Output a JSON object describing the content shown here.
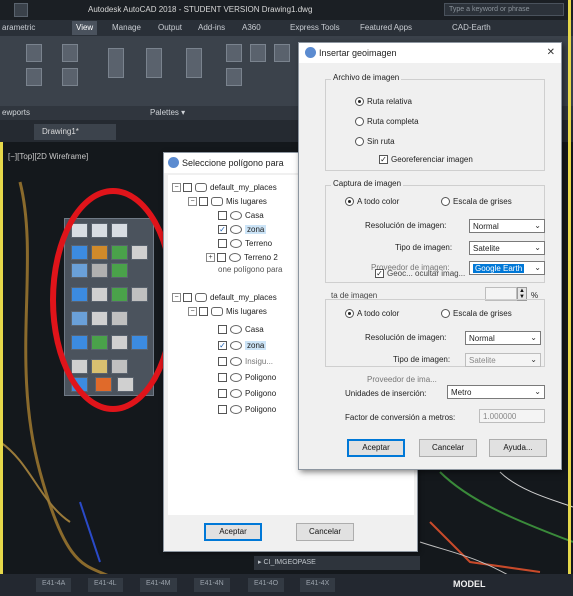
{
  "app": {
    "title": "Autodesk AutoCAD 2018 - STUDENT VERSION    Drawing1.dwg",
    "search_placeholder": "Type a keyword or phrase",
    "ribbon_tabs": [
      "arametric",
      "View",
      "Manage",
      "Output",
      "Add-ins",
      "A360",
      "Express Tools",
      "Featured Apps",
      "CAD-Earth"
    ],
    "active_tab": "View",
    "ribbon_groups": [
      "ewports",
      "Palettes ▾"
    ],
    "file_tab": "Drawing1*",
    "viewport_label": "[−][Top][2D Wireframe]",
    "model_label": "MODEL",
    "layout_tabs": [
      "E41-4A",
      "E41-4L",
      "E41-4M",
      "E41-4N",
      "E41-4O",
      "E41-4X"
    ],
    "command_line": "▸ CI_IMGEOPASE"
  },
  "select_dialog": {
    "title": "Seleccione polígono para",
    "tree_top": [
      {
        "label": "default_my_places",
        "level": 0,
        "expander": "⊟",
        "checked": false
      },
      {
        "label": "Mis lugares",
        "level": 1,
        "expander": "⊟",
        "checked": false
      },
      {
        "label": "Casa",
        "level": 2,
        "checked": false
      },
      {
        "label": "zona",
        "level": 2,
        "checked": true,
        "selected": true
      },
      {
        "label": "Terreno",
        "level": 2,
        "checked": false
      },
      {
        "label": "Terreno 2",
        "level": 2,
        "checked": false,
        "expander": "⊞"
      }
    ],
    "overlap_text": "one polígono para",
    "tree_bottom": [
      {
        "label": "default_my_places",
        "level": 0,
        "expander": "⊟",
        "checked": false
      },
      {
        "label": "Mis lugares",
        "level": 1,
        "expander": "⊟",
        "checked": false
      },
      {
        "label": "Casa",
        "level": 2,
        "checked": false
      },
      {
        "label": "zona",
        "level": 2,
        "checked": true,
        "selected": true
      },
      {
        "label": "Insigu...",
        "level": 2,
        "checked": false
      },
      {
        "label": "Poligono",
        "level": 2,
        "checked": false
      },
      {
        "label": "Poligono",
        "level": 2,
        "checked": false
      },
      {
        "label": "Poligono",
        "level": 2,
        "checked": false
      }
    ],
    "ok_label": "Aceptar",
    "cancel_label": "Cancelar"
  },
  "geo_dialog": {
    "title": "Insertar geoimagen",
    "close": "✕",
    "archivo_group": "Archivo de imagen",
    "path_options": [
      {
        "label": "Ruta relativa",
        "selected": true
      },
      {
        "label": "Ruta completa",
        "selected": false
      },
      {
        "label": "Sin ruta",
        "selected": false
      }
    ],
    "georef_label": "Georeferenciar imagen",
    "georef_checked": true,
    "captura_group": "Captura de imagen",
    "color_options": [
      {
        "label": "A todo color",
        "selected": true
      },
      {
        "label": "Escala de grises",
        "selected": false
      }
    ],
    "resolution_label": "Resolución de imagen:",
    "resolution_value": "Normal",
    "type_label": "Tipo de imagen:",
    "type_value": "Satelite",
    "provider_label": "Proveedor de imagen:",
    "provider_value": "Google Earth",
    "ghost_check_label": "Geoc... ocultar imag...",
    "size_group": "ta de imagen",
    "percent": "%",
    "color_options_2": [
      {
        "label": "A todo color",
        "selected": true
      },
      {
        "label": "Escala de grises",
        "selected": false
      }
    ],
    "resolution_label_2": "Resolución de imagen:",
    "resolution_value_2": "Normal",
    "type_label_2": "Tipo de imagen:",
    "type_value_2": "Satelite",
    "provider_label_2": "Proveedor de ima...",
    "units_label": "Unidades de inserción:",
    "units_value": "Metro",
    "factor_label": "Factor de conversión a metros:",
    "factor_value": "1.000000",
    "ok_label": "Aceptar",
    "cancel_label": "Cancelar",
    "help_label": "Ayuda..."
  }
}
